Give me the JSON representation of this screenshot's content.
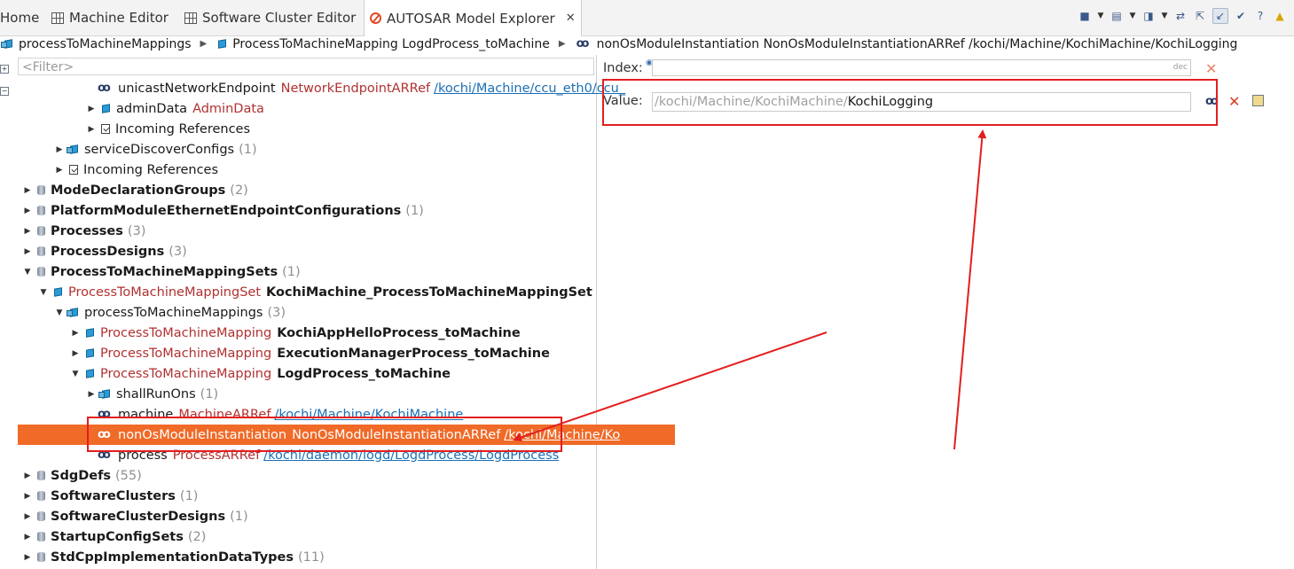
{
  "tabs": [
    {
      "label": "Home"
    },
    {
      "label": "Machine Editor"
    },
    {
      "label": "Software Cluster Editor"
    },
    {
      "label": "AUTOSAR Model Explorer",
      "close": "✕"
    }
  ],
  "breadcrumb": [
    {
      "label": "processToMachineMappings"
    },
    {
      "label": "ProcessToMachineMapping LogdProcess_toMachine"
    },
    {
      "label": "nonOsModuleInstantiation NonOsModuleInstantiationARRef /kochi/Machine/KochiMachine/KochiLogging"
    }
  ],
  "filter": {
    "placeholder": "<Filter>"
  },
  "tree": {
    "unicast": {
      "name": "unicastNetworkEndpoint",
      "type": "NetworkEndpointARRef",
      "ref": "/kochi/Machine/ccu_eth0/ccu_"
    },
    "admin": {
      "name": "adminData",
      "type": "AdminData"
    },
    "incoming1": {
      "name": "Incoming References"
    },
    "serviceDiscover": {
      "name": "serviceDiscoverConfigs",
      "count": "(1)"
    },
    "incoming2": {
      "name": "Incoming References"
    },
    "modeDecl": {
      "name": "ModeDeclarationGroups",
      "count": "(2)"
    },
    "platform": {
      "name": "PlatformModuleEthernetEndpointConfigurations",
      "count": "(1)"
    },
    "processes": {
      "name": "Processes",
      "count": "(3)"
    },
    "processDesigns": {
      "name": "ProcessDesigns",
      "count": "(3)"
    },
    "ptmSets": {
      "name": "ProcessToMachineMappingSets",
      "count": "(1)"
    },
    "ptmSet": {
      "type": "ProcessToMachineMappingSet",
      "name": "KochiMachine_ProcessToMachineMappingSet"
    },
    "ptmMappings": {
      "name": "processToMachineMappings",
      "count": "(3)"
    },
    "m1": {
      "type": "ProcessToMachineMapping",
      "name": "KochiAppHelloProcess_toMachine"
    },
    "m2": {
      "type": "ProcessToMachineMapping",
      "name": "ExecutionManagerProcess_toMachine"
    },
    "m3": {
      "type": "ProcessToMachineMapping",
      "name": "LogdProcess_toMachine"
    },
    "shallRunOns": {
      "name": "shallRunOns",
      "count": "(1)"
    },
    "machine": {
      "name": "machine",
      "type": "MachineARRef",
      "ref": "/kochi/Machine/KochiMachine"
    },
    "nonOs": {
      "name": "nonOsModuleInstantiation",
      "type": "NonOsModuleInstantiationARRef",
      "ref": "/kochi/Machine/Ko"
    },
    "process": {
      "name": "process",
      "type": "ProcessARRef",
      "ref": "/kochi/daemon/logd/LogdProcess/LogdProcess"
    },
    "sdgDefs": {
      "name": "SdgDefs",
      "count": "(55)"
    },
    "swClusters": {
      "name": "SoftwareClusters",
      "count": "(1)"
    },
    "swClusterDesigns": {
      "name": "SoftwareClusterDesigns",
      "count": "(1)"
    },
    "startup": {
      "name": "StartupConfigSets",
      "count": "(2)"
    },
    "stdCpp": {
      "name": "StdCppImplementationDataTypes",
      "count": "(11)"
    }
  },
  "properties": {
    "index_label": "Index:",
    "index_hint": "dec",
    "value_label": "Value:",
    "value_prefix": "/kochi/Machine/KochiMachine/",
    "value_text": "KochiLogging"
  },
  "colors": {
    "selection": "#f06a28",
    "annotation": "#e31e1e",
    "type_text": "#b13131",
    "link_text": "#1a6fb5"
  }
}
